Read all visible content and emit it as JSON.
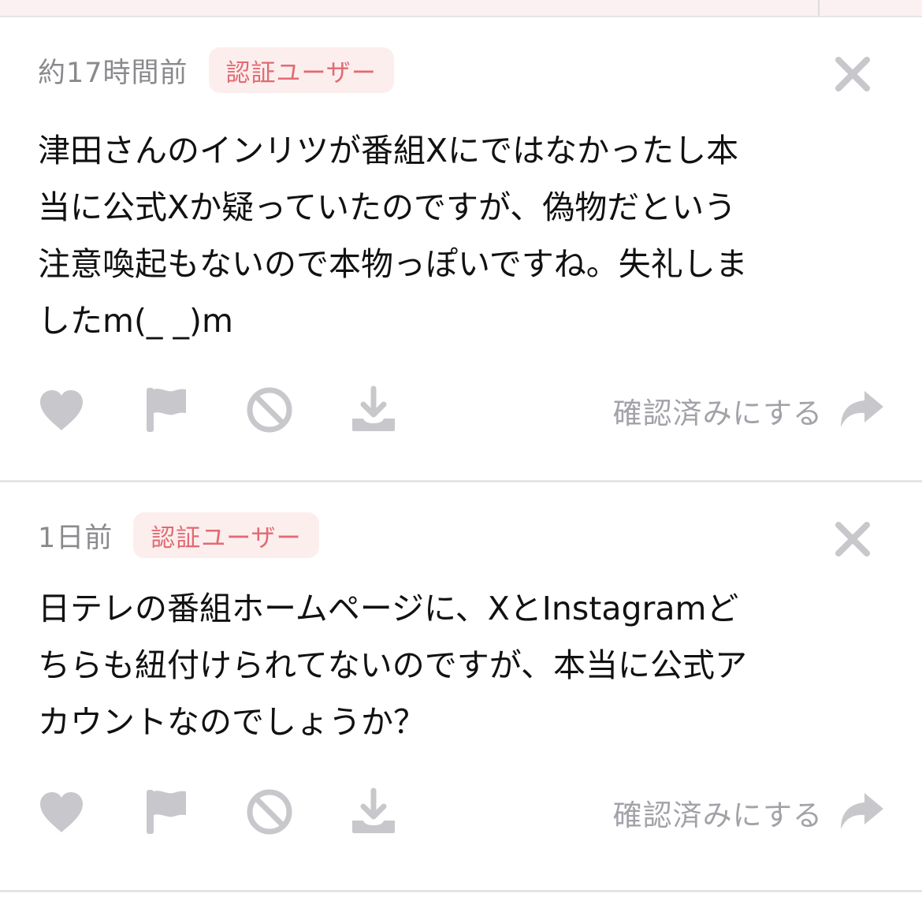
{
  "comments": [
    {
      "timestamp": "約17時間前",
      "badge": "認証ユーザー",
      "body": "津田さんのインリツが番組Xにではなかったし本\n当に公式Xか疑っていたのですが、偽物だという\n注意喚起もないので本物っぽいですね。失礼しま\nしたm(_ _)m",
      "confirm_label": "確認済みにする"
    },
    {
      "timestamp": "1日前",
      "badge": "認証ユーザー",
      "body": "日テレの番組ホームページに、XとInstagramど\nちらも紐付けられてないのですが、本当に公式ア\nカウントなのでしょうか？",
      "confirm_label": "確認済みにする"
    }
  ],
  "icons": {
    "close": "close-icon",
    "like": "heart-icon",
    "report": "flag-icon",
    "block": "block-icon",
    "save": "download-icon",
    "reply": "reply-arrow-icon"
  },
  "colors": {
    "icon_gray": "#c8c8cc",
    "badge_bg": "#fdeeee",
    "badge_text": "#e06b72",
    "timestamp": "#8a8a8e",
    "confirm_text": "#a2a2a8"
  }
}
